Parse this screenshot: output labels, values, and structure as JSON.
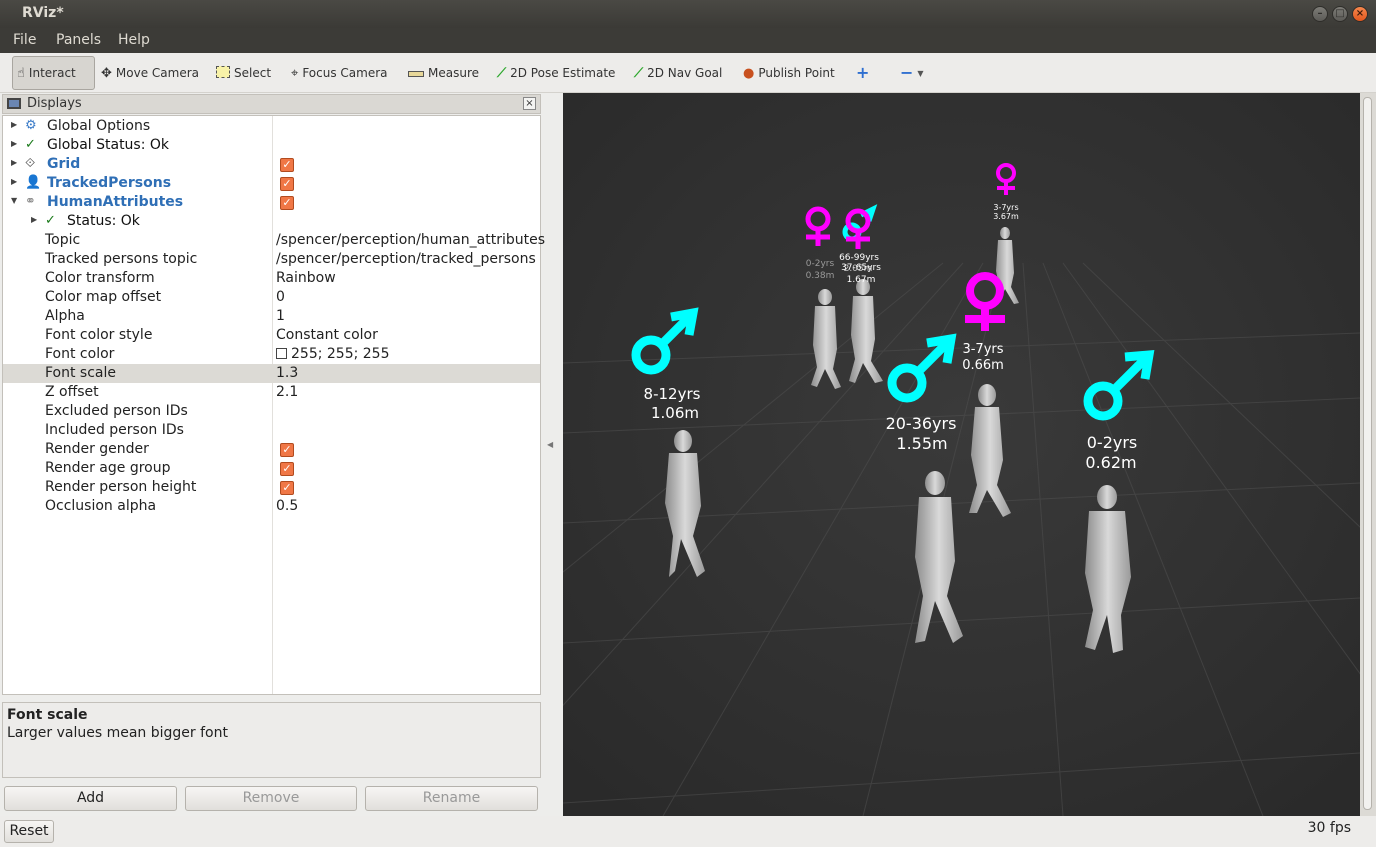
{
  "window": {
    "title": "RViz*"
  },
  "menu": {
    "file": "File",
    "panels": "Panels",
    "help": "Help"
  },
  "toolbar": {
    "interact": "Interact",
    "move_camera": "Move Camera",
    "select": "Select",
    "focus_camera": "Focus Camera",
    "measure": "Measure",
    "pose_estimate": "2D Pose Estimate",
    "nav_goal": "2D Nav Goal",
    "publish_point": "Publish Point"
  },
  "displays": {
    "title": "Displays",
    "global_options": "Global Options",
    "global_status": "Global Status: Ok",
    "grid": "Grid",
    "tracked_persons": "TrackedPersons",
    "human_attributes": "HumanAttributes",
    "status": "Status: Ok",
    "properties": [
      {
        "name": "Topic",
        "value": "/spencer/perception/human_attributes"
      },
      {
        "name": "Tracked persons topic",
        "value": "/spencer/perception/tracked_persons"
      },
      {
        "name": "Color transform",
        "value": "Rainbow"
      },
      {
        "name": "Color map offset",
        "value": "0"
      },
      {
        "name": "Alpha",
        "value": "1"
      },
      {
        "name": "Font color style",
        "value": "Constant color"
      },
      {
        "name": "Font color",
        "value": "255; 255; 255"
      },
      {
        "name": "Font scale",
        "value": "1.3"
      },
      {
        "name": "Z offset",
        "value": "2.1"
      },
      {
        "name": "Excluded person IDs",
        "value": ""
      },
      {
        "name": "Included person IDs",
        "value": ""
      },
      {
        "name": "Render gender",
        "value": ""
      },
      {
        "name": "Render age group",
        "value": ""
      },
      {
        "name": "Render person height",
        "value": ""
      },
      {
        "name": "Occlusion alpha",
        "value": "0.5"
      }
    ]
  },
  "description": {
    "title": "Font scale",
    "text": "Larger values mean bigger font"
  },
  "buttons": {
    "add": "Add",
    "remove": "Remove",
    "rename": "Rename",
    "reset": "Reset"
  },
  "status": {
    "fps": "30 fps"
  },
  "scene": {
    "labels": [
      {
        "age": "8-12yrs",
        "height": "1.06m"
      },
      {
        "age": "20-36yrs",
        "height": "1.55m"
      },
      {
        "age": "0-2yrs",
        "height": "0.62m"
      },
      {
        "age": "3-7yrs",
        "height": "0.66m"
      },
      {
        "age": "3-7yrs",
        "height": "3.67m"
      },
      {
        "age": "0-2yrs",
        "height": "0.38m"
      },
      {
        "age": "66-99yrs",
        "height": "1.67m"
      },
      {
        "age": "37-65yrs",
        "height": "2.05m"
      }
    ],
    "male_color": "#00ffff",
    "female_color": "#ff00ff"
  }
}
